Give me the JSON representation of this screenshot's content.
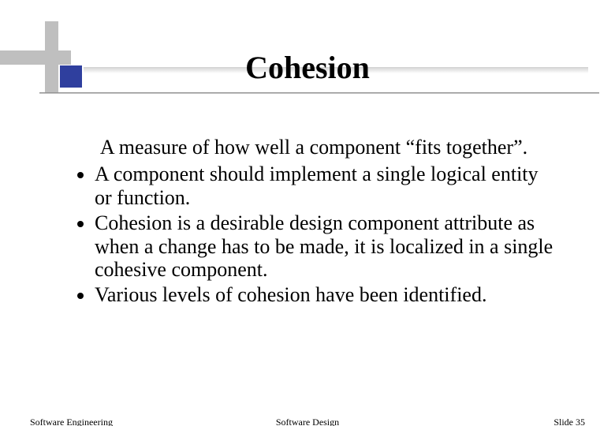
{
  "title": "Cohesion",
  "intro": "A measure of how well a component “fits together”.",
  "bullets": [
    "A component should implement a single logical entity or function.",
    "Cohesion is a desirable design component attribute as when a change has to be made, it is localized in a single cohesive component.",
    "Various levels of cohesion have been identified."
  ],
  "footer": {
    "left": "Software Engineering",
    "center": "Software Design",
    "right": "Slide  35"
  }
}
